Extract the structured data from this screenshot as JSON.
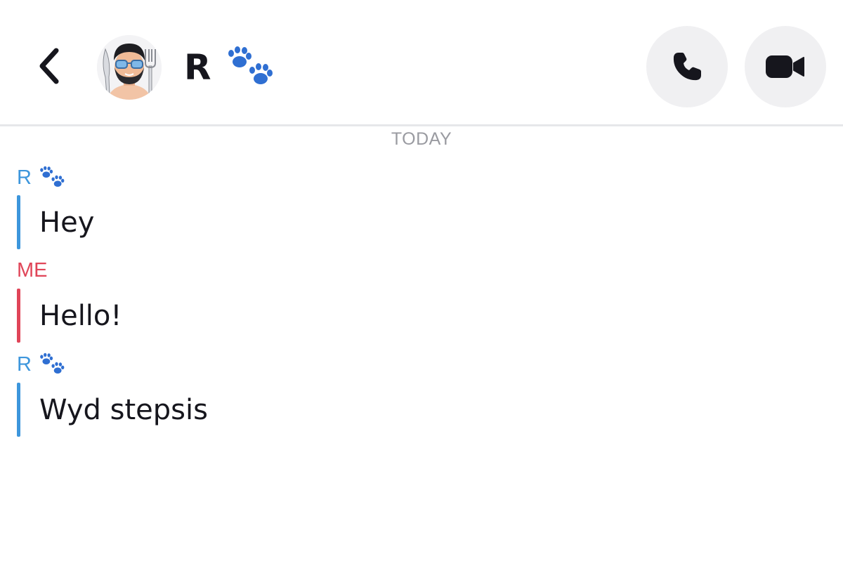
{
  "header": {
    "title": "R",
    "title_emoji": "paw-prints-icon",
    "back_icon": "chevron-left-icon",
    "call_icon": "phone-icon",
    "video_icon": "video-camera-icon",
    "avatar": "bitmoji-avatar"
  },
  "chat": {
    "date_label": "TODAY",
    "messages": [
      {
        "sender": "R",
        "sender_emoji": "paw-prints-icon",
        "text": "Hey"
      },
      {
        "sender": "ME",
        "text": "Hello!"
      },
      {
        "sender": "R",
        "sender_emoji": "paw-prints-icon",
        "text": "Wyd stepsis"
      }
    ]
  },
  "colors": {
    "friend_accent": "#3d96dc",
    "me_accent": "#e04558",
    "paw_blue": "#2f6fd2",
    "date_gray": "#9a9ba1",
    "button_bg": "#f0f0f2"
  }
}
